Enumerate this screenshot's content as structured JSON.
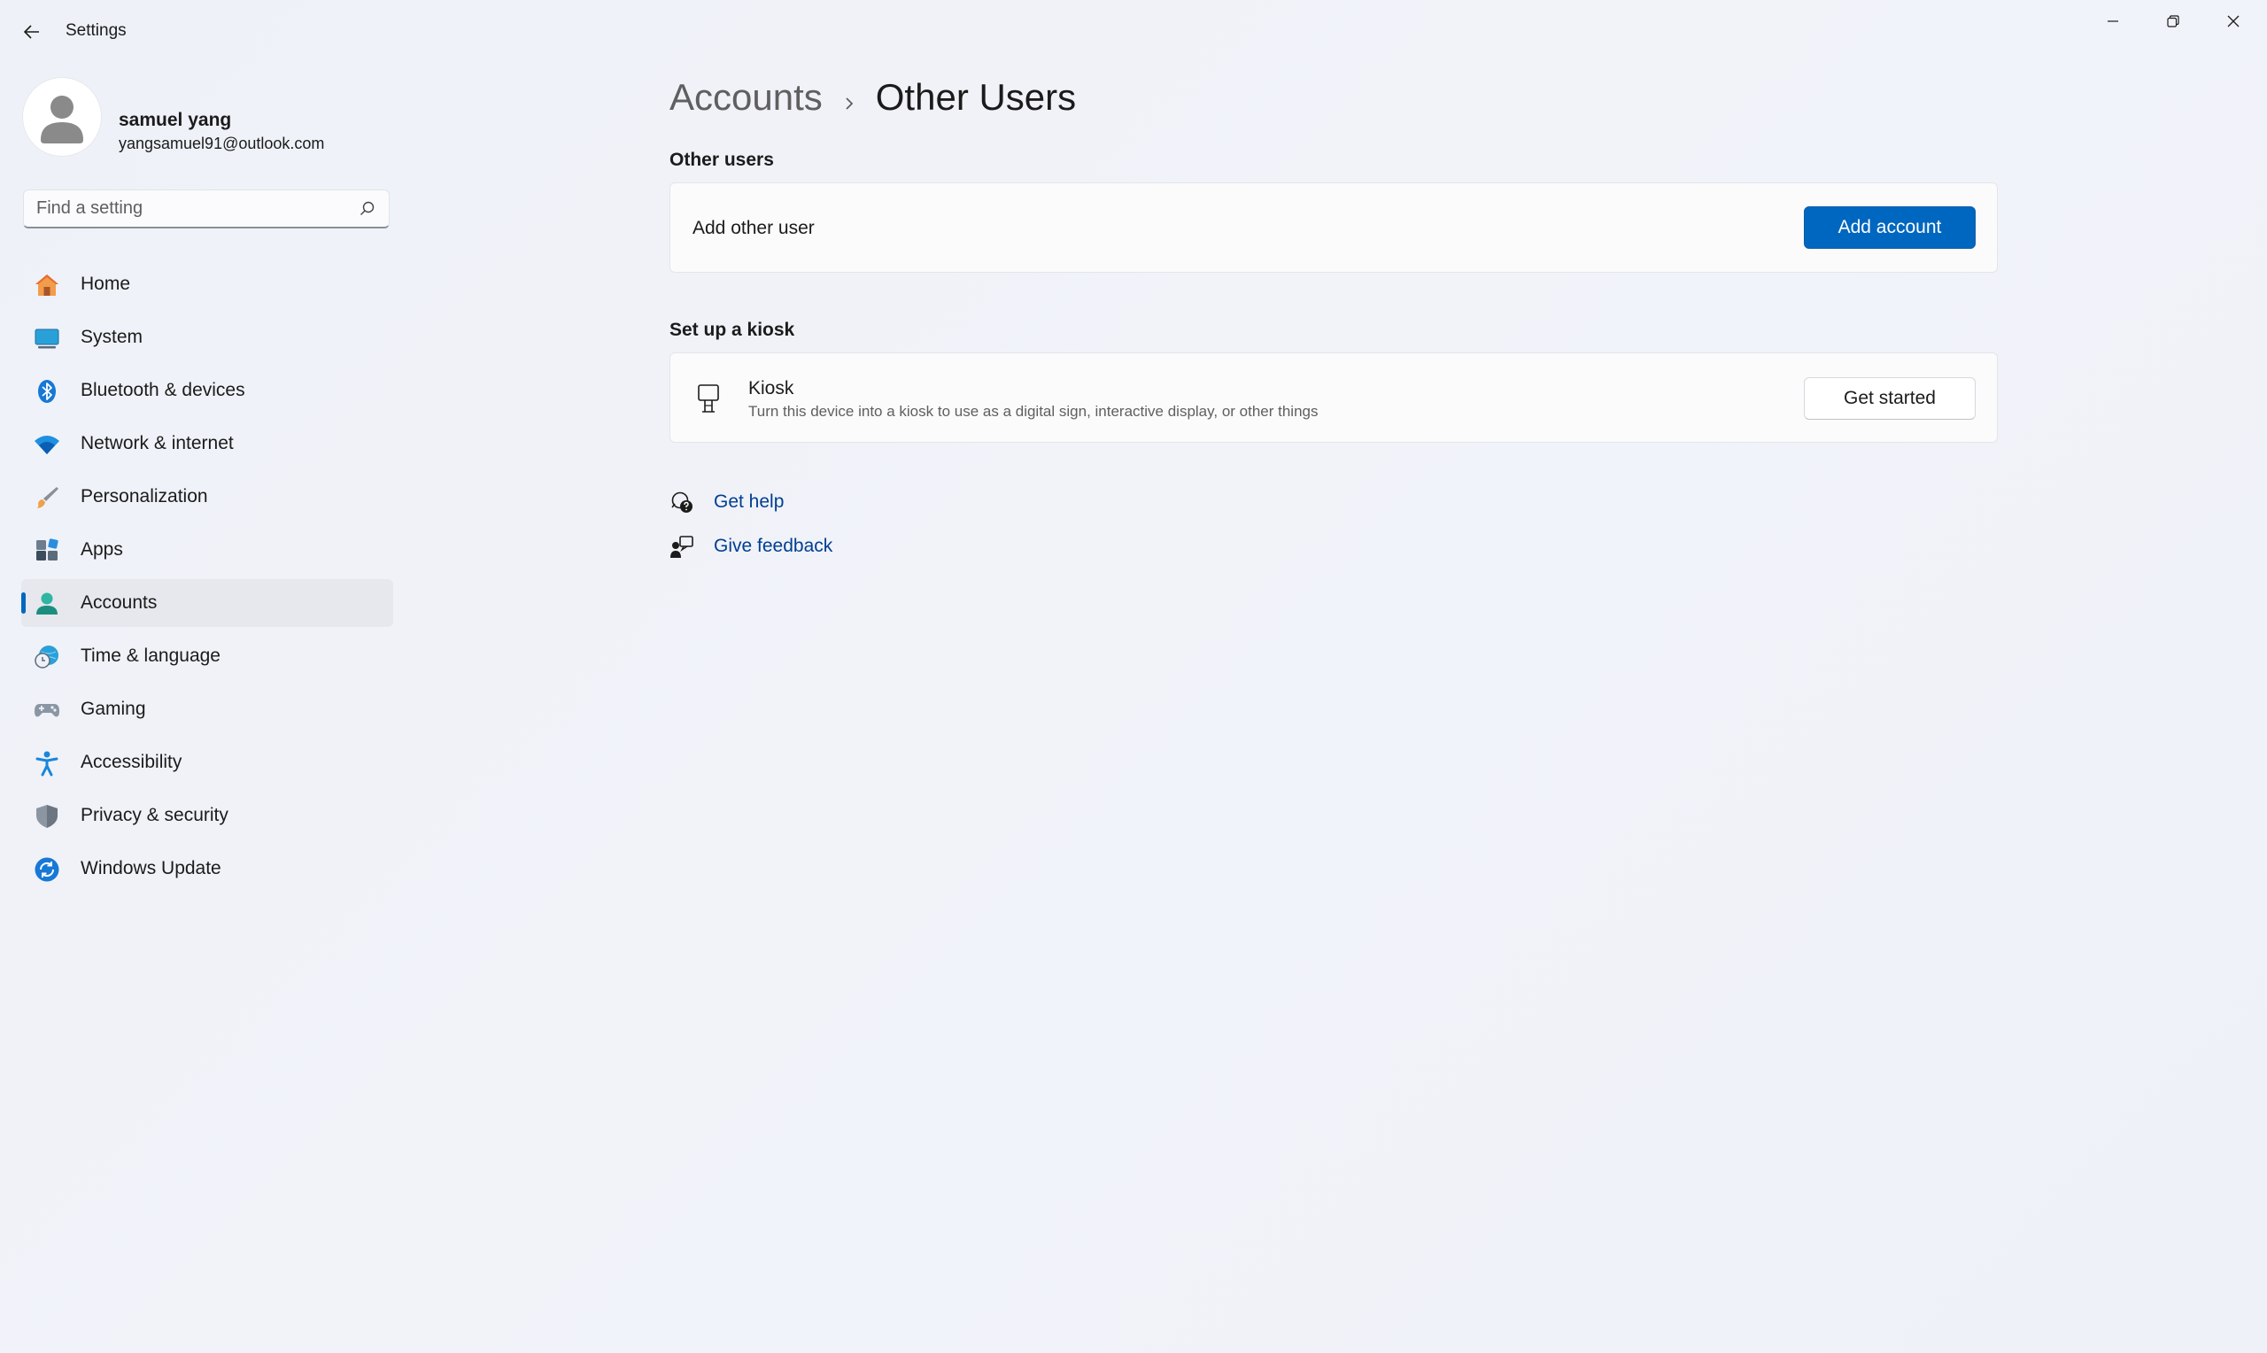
{
  "window": {
    "title": "Settings",
    "controls": [
      "minimize",
      "restore",
      "close"
    ]
  },
  "profile": {
    "name": "samuel yang",
    "email": "yangsamuel91@outlook.com"
  },
  "search": {
    "placeholder": "Find a setting",
    "value": ""
  },
  "nav": {
    "items": [
      {
        "label": "Home",
        "icon": "home-icon"
      },
      {
        "label": "System",
        "icon": "system-icon"
      },
      {
        "label": "Bluetooth & devices",
        "icon": "bluetooth-icon"
      },
      {
        "label": "Network & internet",
        "icon": "wifi-icon"
      },
      {
        "label": "Personalization",
        "icon": "brush-icon"
      },
      {
        "label": "Apps",
        "icon": "apps-icon"
      },
      {
        "label": "Accounts",
        "icon": "accounts-icon",
        "active": true
      },
      {
        "label": "Time & language",
        "icon": "globe-clock-icon"
      },
      {
        "label": "Gaming",
        "icon": "gamepad-icon"
      },
      {
        "label": "Accessibility",
        "icon": "accessibility-icon"
      },
      {
        "label": "Privacy & security",
        "icon": "shield-icon"
      },
      {
        "label": "Windows Update",
        "icon": "update-icon"
      }
    ]
  },
  "breadcrumb": {
    "parent": "Accounts",
    "current": "Other Users"
  },
  "other_users": {
    "section_title": "Other users",
    "add_label": "Add other user",
    "add_button": "Add account"
  },
  "kiosk": {
    "section_title": "Set up a kiosk",
    "title": "Kiosk",
    "description": "Turn this device into a kiosk to use as a digital sign, interactive display, or other things",
    "button": "Get started"
  },
  "help": {
    "get_help": "Get help",
    "give_feedback": "Give feedback"
  },
  "colors": {
    "accent": "#0067c0",
    "link": "#003e92",
    "background": "#eef1f7"
  }
}
